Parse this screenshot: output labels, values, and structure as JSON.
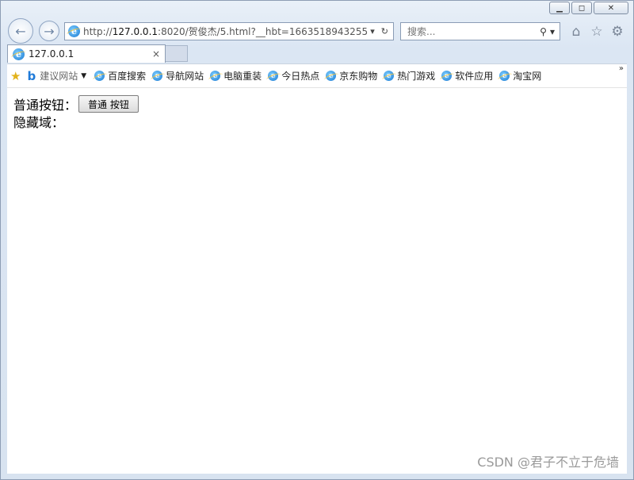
{
  "window": {
    "minimize_glyph": "▁",
    "maximize_glyph": "◻",
    "close_glyph": "✕"
  },
  "navigation": {
    "back_glyph": "←",
    "forward_glyph": "→",
    "url_host": "http://127.0.0.1",
    "url_rest": ":8020/贺俊杰/5.html?__hbt=1663518943255",
    "url_host_bold": "127.0.0.1",
    "url_prefix": "http://",
    "dropdown_glyph": "▾",
    "refresh_glyph": "↻",
    "search_placeholder": "搜索...",
    "search_glyph": "⚲",
    "search_dropdown_glyph": "▾",
    "home_glyph": "⌂",
    "favorites_glyph": "☆",
    "settings_glyph": "⚙"
  },
  "tab": {
    "title": "127.0.0.1",
    "close_glyph": "×"
  },
  "favorites_bar": {
    "suggested_label": "建议网站",
    "items": [
      "百度搜索",
      "导航网站",
      "电脑重装",
      "今日热点",
      "京东购物",
      "热门游戏",
      "软件应用",
      "淘宝网"
    ],
    "overflow_glyph": "»"
  },
  "page": {
    "button_label_text": "普通按钮：",
    "button_text": "普通 按钮",
    "hidden_label_text": "隐藏域："
  },
  "watermark": "CSDN @君子不立于危墙",
  "icons": [
    "back-icon",
    "forward-icon",
    "ie-icon",
    "refresh-icon",
    "search-icon",
    "home-icon",
    "favorites-star-icon",
    "settings-gear-icon",
    "favorites-icon",
    "bing-icon"
  ]
}
